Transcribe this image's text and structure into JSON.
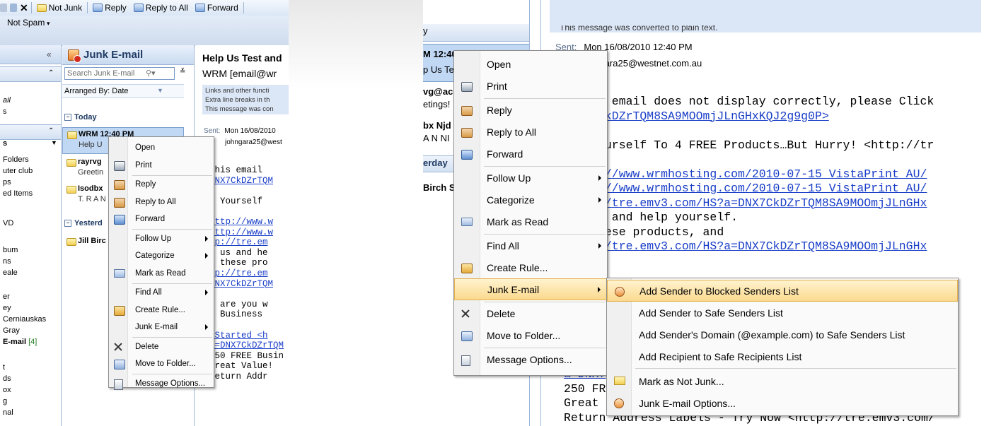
{
  "left": {
    "toolbar": {
      "items": [
        "Not Junk",
        "Reply",
        "Reply to All",
        "Forward"
      ],
      "not_spam_label": "Not Spam"
    },
    "nav": {
      "rows": [
        "ail",
        "s",
        "s",
        "Folders",
        "uter club",
        "ps",
        "ed Items",
        "VD",
        "bum",
        "ns",
        "eale",
        "er",
        "ey",
        "Cerniauskas",
        "Gray",
        "E-mail",
        "[4]",
        "t",
        "ds",
        "ox",
        "g",
        "nal"
      ]
    },
    "list": {
      "header_title": "Junk E-mail",
      "search_placeholder": "Search Junk E-mail",
      "arranged_by": "Arranged By: Date",
      "group_today": "Today",
      "group_yesterday": "Yesterd",
      "mails": [
        {
          "from": "WRM  12:40 PM",
          "subject": "Help U"
        },
        {
          "from": "rayrvg",
          "subject": "Greetin"
        },
        {
          "from": "Isodbx",
          "subject": "T. R A N"
        },
        {
          "from": "Jill Birc",
          "subject": ""
        }
      ]
    },
    "reading": {
      "title": "Help Us Test and",
      "from": "WRM [email@wr",
      "info_lines": [
        "Links and other functi",
        "Extra line breaks in th",
        "This message was con"
      ],
      "sent_label": "Sent:",
      "sent_value": "Mon 16/08/2010",
      "to_value": "johngara25@west",
      "body_lines": [
        "this email",
        "DNX7CkDZrTQM",
        "",
        "p Yourself",
        "",
        "http://www.w",
        "http://www.w",
        "tp://tre.em",
        "p us and he",
        "t these pro",
        "tp://tre.em",
        "DNX7CkDZrTQM",
        "",
        "t are you w",
        "E Business",
        "",
        " Started <h",
        "a=DNX7CkDZrTQM",
        "250 FREE Busin",
        "Great Value!",
        "Return Addr"
      ]
    },
    "menu": {
      "items": [
        "Open",
        "Print",
        "Reply",
        "Reply to All",
        "Forward",
        "Follow Up",
        "Categorize",
        "Mark as Read",
        "Find All",
        "Create Rule...",
        "Junk E-mail",
        "Delete",
        "Move to Folder...",
        "Message Options..."
      ]
    }
  },
  "right": {
    "list": {
      "lines": [
        "y",
        "M  12:40 PM",
        "p Us Te",
        "vg@ac",
        "etings!",
        "bx Njd",
        "A N NI",
        "erday",
        "Birch S"
      ]
    },
    "reading": {
      "info_line": "This message was converted to plain text.",
      "sent_label": "Sent:",
      "sent_value": "Mon 16/08/2010 12:40 PM",
      "to_value": "hngara25@westnet.com.au",
      "body_lines": [
        "s email does not display correctly, please Click",
        "CkDZrTQM8SA9MOOmjJLnGHxKQJ2g9g0P>",
        "",
        "ourself To 4 FREE Products…But Hurry! <http://tr",
        "",
        "://www.wrmhosting.com/2010-07-15_VistaPrint_AU/",
        "://www.wrmhosting.com/2010-07-15_VistaPrint_AU/",
        "//tre.emv3.com/HS?a=DNX7CkDZrTQM8SA9MOOmjJLnGHx",
        "s and help yourself.",
        "hese products, and",
        "//tre.emv3.com/HS?a=DNX7CkDZrTQM8SA9MOOmjJLnGHx"
      ],
      "lower_lines": [
        "a=DNX7",
        "250 FR",
        "Great",
        "Return Address Labels - Try Now <http://tre.emv3.com/"
      ]
    },
    "menu": {
      "items": [
        "Open",
        "Print",
        "Reply",
        "Reply to All",
        "Forward",
        "Follow Up",
        "Categorize",
        "Mark as Read",
        "Find All",
        "Create Rule...",
        "Junk E-mail",
        "Delete",
        "Move to Folder...",
        "Message Options..."
      ]
    },
    "submenu": {
      "items": [
        "Add Sender to Blocked Senders List",
        "Add Sender to Safe Senders List",
        "Add Sender's Domain (@example.com) to Safe Senders List",
        "Add Recipient to Safe Recipients List",
        "Mark as Not Junk...",
        "Junk E-mail Options..."
      ]
    }
  }
}
